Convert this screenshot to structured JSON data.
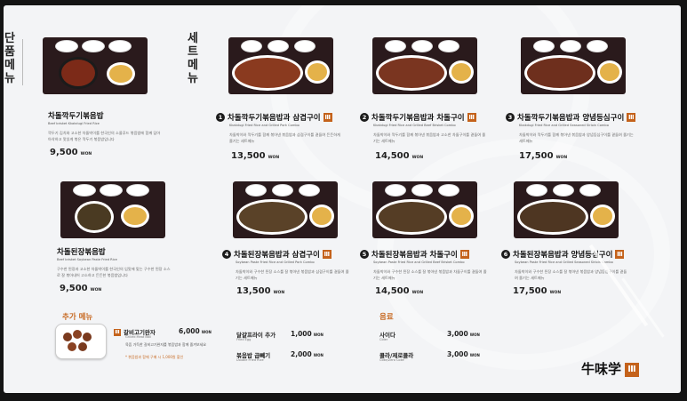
{
  "sections": {
    "single_menu_title": "단품메뉴",
    "set_menu_title": "세트메뉴"
  },
  "single_items": [
    {
      "name": "차돌깍두기볶음밥",
      "sub": "Beef brisket Kkakdugi Fried Rice",
      "desc": "깍두기 김치와 고소한 차돌박이를 한국인의 소울푸드 볶음밥에 함께 담아 아삭하고 맛있게 볶은 깍두기 볶음밥입니다",
      "price": "9,500",
      "won": "WON"
    },
    {
      "name": "차돌된장볶음밥",
      "sub": "Beef brisket Soybean Paste Fried Rice",
      "desc": "구수한 된장과 고소한 차돌박이를 한국인의 입맛에 맞는 구수한 된장 소스로 잘 볶아내어 고소하고 든든한 볶음밥입니다",
      "price": "9,500",
      "won": "WON"
    }
  ],
  "set_items": [
    {
      "num": "1",
      "name": "차돌깍두기볶음밥과 삼겹구이",
      "badge": "Ⅲ",
      "sub": "Kkakdugi Fried Rice and Grilled Pork Combo",
      "desc": "차돌박이와 깍두기를 함께 볶아낸 볶음밥과 삼겹구이를 곁들여 든든하게 즐기는 세트메뉴",
      "price": "13,500",
      "won": "WON"
    },
    {
      "num": "2",
      "name": "차돌깍두기볶음밥과 차돌구이",
      "badge": "Ⅲ",
      "sub": "Kkakdugi Fried Rice and Grilled Beef Brisket Combo",
      "desc": "차돌박이와 깍두기를 함께 볶아낸 볶음밥과 고소한 차돌구이를 곁들여 즐기는 세트메뉴",
      "price": "14,500",
      "won": "WON"
    },
    {
      "num": "3",
      "name": "차돌깍두기볶음밥과 양념등심구이",
      "badge": "Ⅲ",
      "sub": "Kkakdugi Fried Rice and Grilled Seasoned Sirloin Combo",
      "desc": "차돌박이와 깍두기를 함께 볶아낸 볶음밥과 양념등심구이를 곁들여 즐기는 세트메뉴",
      "price": "17,500",
      "won": "WON"
    },
    {
      "num": "4",
      "name": "차돌된장볶음밥과 삼겹구이",
      "badge": "Ⅲ",
      "sub": "Soybean Paste Fried Rice and Grilled Pork Combo",
      "desc": "차돌박이와 구수한 된장 소스를 잘 볶아낸 볶음밥과 삼겹구이를 곁들여 즐기는 세트메뉴",
      "price": "13,500",
      "won": "WON"
    },
    {
      "num": "5",
      "name": "차돌된장볶음밥과 차돌구이",
      "badge": "Ⅲ",
      "sub": "Soybean Paste Fried Rice and Grilled Beef Brisket Combo",
      "desc": "차돌박이와 구수한 된장 소스를 잘 볶아낸 볶음밥과 차돌구이를 곁들여 즐기는 세트메뉴",
      "price": "14,500",
      "won": "WON"
    },
    {
      "num": "6",
      "name": "차돌된장볶음밥과 양념등심구이",
      "badge": "Ⅲ",
      "sub": "Soybean Paste Fried Rice and Grilled Seasoned Sirloin Combo",
      "desc": "차돌박이와 구수한 된장 소스를 잘 볶아낸 볶음밥과 양념등심구이를 곁들여 즐기는 세트메뉴",
      "price": "17,500",
      "won": "WON"
    }
  ],
  "extras": {
    "title": "추가 메뉴",
    "galbi": {
      "name": "갈비고기완자",
      "badge": "Ⅲ",
      "sub": "Grilled Meat Ball",
      "desc": "육즙 가득한 갈비고기완자를 볶음밥과 함께 즐겨보세요",
      "note": "* 볶음밥과 함께 구매 시 1,000원 할인",
      "price": "6,000",
      "won": "WON"
    },
    "egg": {
      "name": "달걀프라이 추가",
      "sub": "Fried Egg",
      "price": "1,000",
      "won": "WON"
    },
    "rice": {
      "name": "볶음밥 곱빼기",
      "sub": "Double Fried Rice",
      "price": "2,000",
      "won": "WON"
    }
  },
  "drinks": {
    "title": "음료",
    "cider": {
      "name": "사이다",
      "sub": "Cider",
      "price": "3,000",
      "won": "WON"
    },
    "cola": {
      "name": "콜라/제로콜라",
      "sub": "Coke/Zero Coke",
      "price": "3,000",
      "won": "WON"
    }
  },
  "logo": {
    "text": "牛味学",
    "mark": "Ⅲ"
  },
  "colors": {
    "accent": "#c4621b",
    "tray": "#2a1a1c",
    "screen": "#f3f4f6"
  }
}
